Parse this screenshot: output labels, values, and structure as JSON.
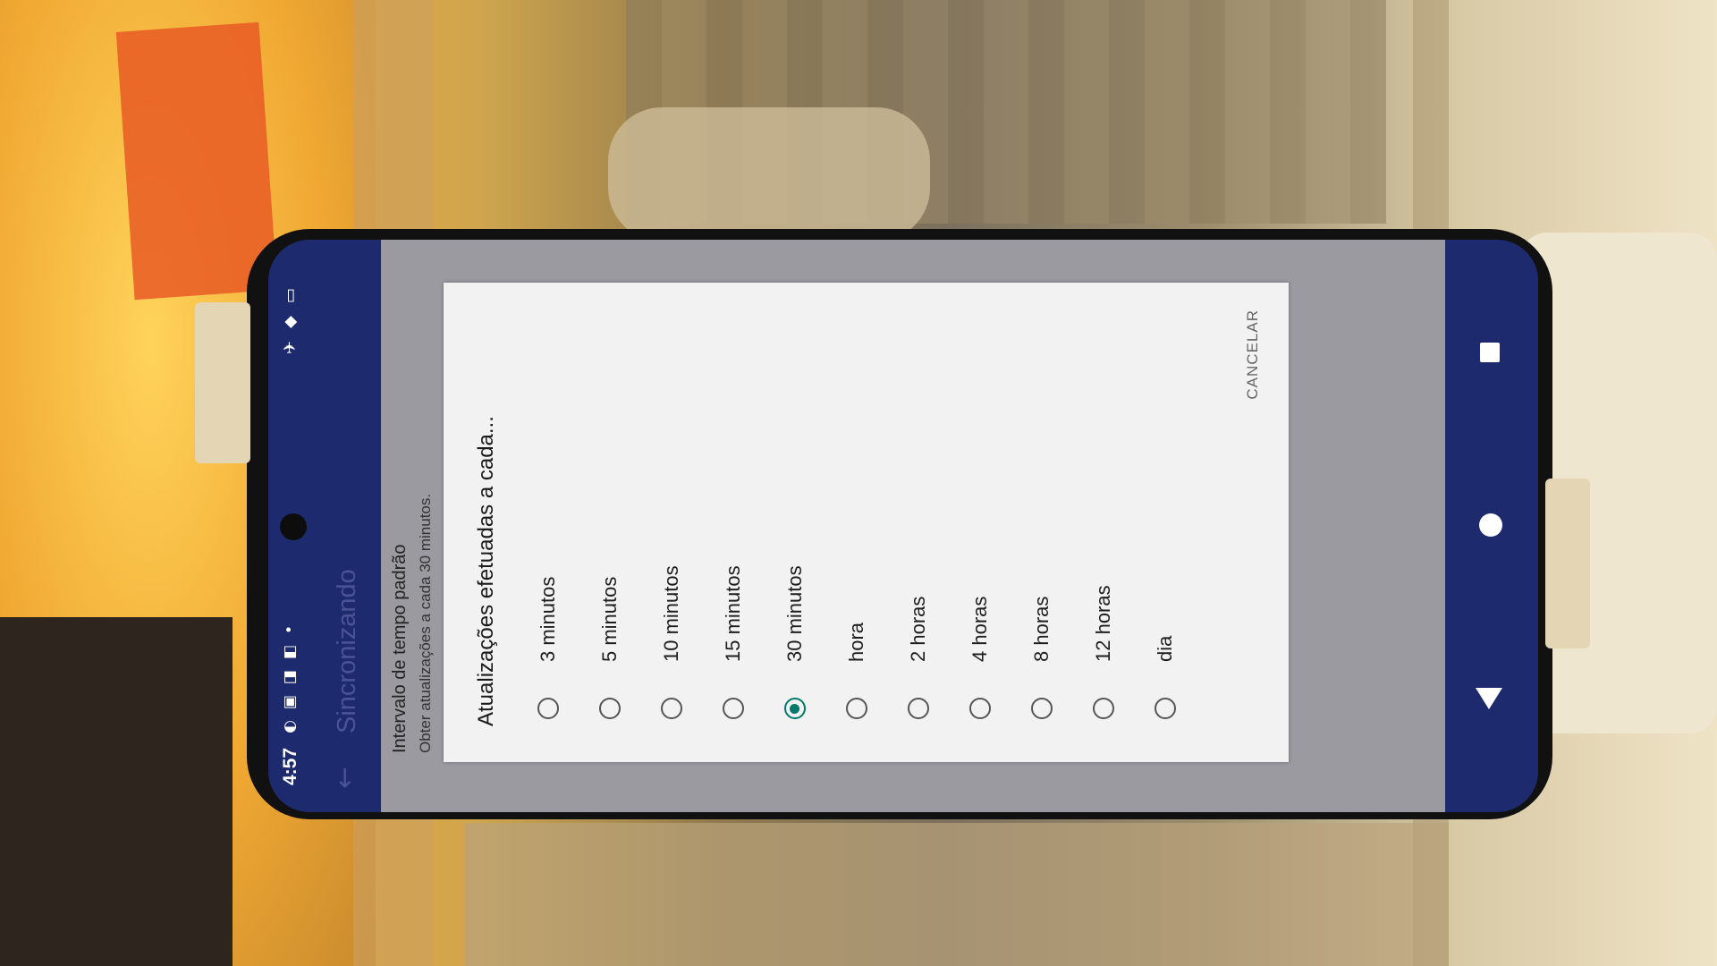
{
  "status_bar": {
    "time": "4:57",
    "left_icons": "◐▣◨◧•",
    "right_icons": "✈◆▭"
  },
  "app_bar": {
    "back_icon": "back-arrow-icon",
    "title": "Sincronizando"
  },
  "preference": {
    "title": "Intervalo de tempo padrão",
    "summary": "Obter atualizações a cada 30 minutos."
  },
  "dialog": {
    "title": "Atualizações efetuadas a cada...",
    "options": [
      {
        "label": "3 minutos",
        "selected": false
      },
      {
        "label": "5 minutos",
        "selected": false
      },
      {
        "label": "10 minutos",
        "selected": false
      },
      {
        "label": "15 minutos",
        "selected": false
      },
      {
        "label": "30 minutos",
        "selected": true
      },
      {
        "label": "hora",
        "selected": false
      },
      {
        "label": "2 horas",
        "selected": false
      },
      {
        "label": "4 horas",
        "selected": false
      },
      {
        "label": "8 horas",
        "selected": false
      },
      {
        "label": "12 horas",
        "selected": false
      },
      {
        "label": "dia",
        "selected": false
      }
    ],
    "cancel_label": "CANCELAR"
  },
  "colors": {
    "app_bar": "#1e2a6e",
    "radio_selected": "#00796b",
    "dialog_bg": "#f2f2f2"
  }
}
